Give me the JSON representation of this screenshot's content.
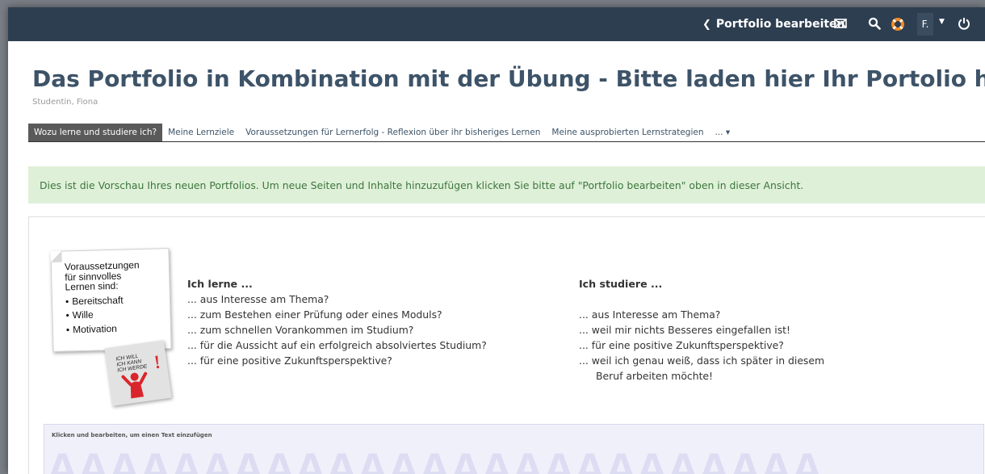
{
  "topbar": {
    "edit_label": "Portfolio bearbeiten",
    "user_initial": "F."
  },
  "page": {
    "title": "Das Portfolio in Kombination mit der Übung - Bitte laden hier Ihr Portolio hoch",
    "author": "Studentin, Fiona"
  },
  "tabs": [
    {
      "label": "Wozu lerne und studiere ich?",
      "active": true
    },
    {
      "label": "Meine Lernziele",
      "active": false
    },
    {
      "label": "Voraussetzungen für Lernerfolg - Reflexion über ihr bisheriges Lernen",
      "active": false
    },
    {
      "label": "Meine ausprobierten Lernstrategien",
      "active": false
    },
    {
      "label": "... ▾",
      "active": false
    }
  ],
  "notice": "Dies ist die Vorschau Ihres neuen Portfolios. Um neue Seiten und Inhalte hinzuzufügen klicken Sie bitte auf \"Portfolio bearbeiten\" oben in dieser Ansicht.",
  "sticky_note": {
    "heading_lines": [
      "Voraussetzungen",
      "für sinnvolles",
      "Lernen sind:"
    ],
    "items": [
      "Bereitschaft",
      "Wille",
      "Motivation"
    ],
    "sign_lines": [
      "ICH WILL",
      "ICH KANN",
      "ICH WERDE"
    ]
  },
  "learn": {
    "heading": "Ich lerne ...",
    "lines": [
      "... aus Interesse am Thema?",
      "... zum Bestehen einer Prüfung oder eines Moduls?",
      "... zum schnellen Vorankommen im Studium?",
      "... für die Aussicht auf ein erfolgreich absolviertes Studium?",
      "... für eine positive Zukunftsperspektive?"
    ]
  },
  "study": {
    "heading": "Ich studiere ...",
    "lines": [
      "... aus Interesse am Thema?",
      "... weil mir nichts Besseres eingefallen ist!",
      "... für eine positive Zukunftsperspektive?",
      "... weil ich genau weiß, dass ich später in diesem",
      "Beruf arbeiten möchte!"
    ]
  },
  "editbox": {
    "hint": "Klicken und bearbeiten, um einen Text einzufügen",
    "watermark": "AAAAAAAAAAAAAAAAAAAAAAAAA"
  },
  "colors": {
    "topbar": "#2d3e50",
    "title": "#3d5368",
    "notice_bg": "#dff0d8",
    "notice_text": "#3c763d"
  }
}
